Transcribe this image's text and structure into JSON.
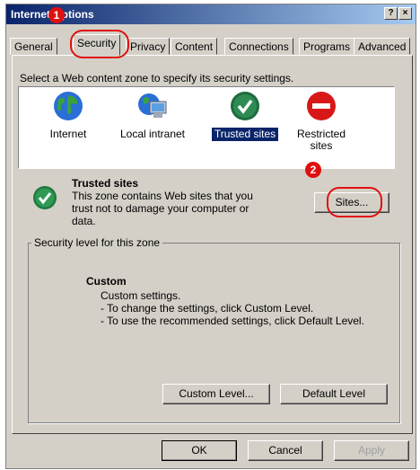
{
  "window": {
    "title": "Internet Options",
    "help_label": "?",
    "close_label": "×"
  },
  "tabs": [
    {
      "label": "General"
    },
    {
      "label": "Security",
      "active": true
    },
    {
      "label": "Privacy"
    },
    {
      "label": "Content"
    },
    {
      "label": "Connections"
    },
    {
      "label": "Programs"
    },
    {
      "label": "Advanced"
    }
  ],
  "security": {
    "instruction": "Select a Web content zone to specify its security settings.",
    "zones": [
      {
        "label": "Internet",
        "icon": "globe-icon"
      },
      {
        "label": "Local intranet",
        "icon": "intranet-computer-icon"
      },
      {
        "label": "Trusted sites",
        "icon": "checkmark-icon",
        "selected": true
      },
      {
        "label": "Restricted sites",
        "icon": "no-entry-icon"
      }
    ],
    "selected_zone": {
      "title": "Trusted sites",
      "description_line1": "This zone contains Web sites that you",
      "description_line2": "trust not to damage your computer or",
      "description_line3": "data."
    },
    "sites_button": "Sites...",
    "security_level": {
      "legend": "Security level for this zone",
      "level_name": "Custom",
      "line1": "Custom settings.",
      "line2": "- To change the settings, click Custom Level.",
      "line3": "- To use the recommended settings, click Default Level."
    },
    "custom_level_button": "Custom Level...",
    "default_level_button": "Default Level"
  },
  "footer": {
    "ok": "OK",
    "cancel": "Cancel",
    "apply": "Apply"
  },
  "annotations": {
    "callout1": "1",
    "callout2": "2",
    "color": "#e01010"
  }
}
